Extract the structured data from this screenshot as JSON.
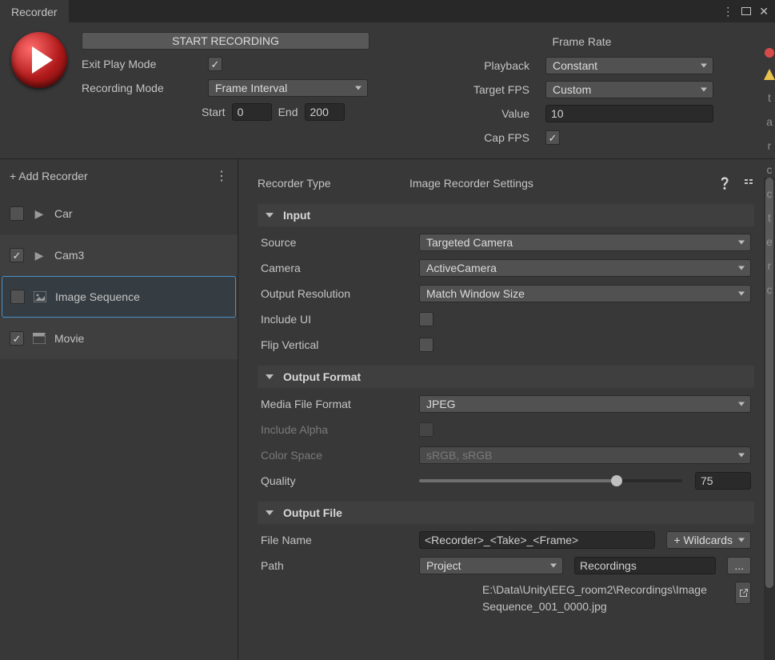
{
  "window": {
    "title": "Recorder"
  },
  "record": {
    "button": "START RECORDING",
    "exit_label": "Exit Play Mode",
    "exit_checked": true,
    "mode_label": "Recording Mode",
    "mode_value": "Frame Interval",
    "start_label": "Start",
    "start_value": "0",
    "end_label": "End",
    "end_value": "200"
  },
  "framerate": {
    "heading": "Frame Rate",
    "playback_label": "Playback",
    "playback_value": "Constant",
    "targetfps_label": "Target FPS",
    "targetfps_value": "Custom",
    "value_label": "Value",
    "value_value": "10",
    "capfps_label": "Cap FPS",
    "capfps_checked": true
  },
  "sidebar": {
    "add": "+ Add Recorder",
    "items": [
      {
        "label": "Car",
        "checked": false,
        "icon": "play"
      },
      {
        "label": "Cam3",
        "checked": true,
        "icon": "play"
      },
      {
        "label": "Image Sequence",
        "checked": false,
        "icon": "image",
        "selected": true
      },
      {
        "label": "Movie",
        "checked": true,
        "icon": "clapper"
      }
    ]
  },
  "inspector": {
    "type_label": "Recorder Type",
    "type_value": "Image Recorder Settings",
    "input": {
      "heading": "Input",
      "source_label": "Source",
      "source_value": "Targeted Camera",
      "camera_label": "Camera",
      "camera_value": "ActiveCamera",
      "outres_label": "Output Resolution",
      "outres_value": "Match Window Size",
      "includeui_label": "Include UI",
      "includeui_checked": false,
      "flip_label": "Flip Vertical",
      "flip_checked": false
    },
    "outputformat": {
      "heading": "Output Format",
      "mediaformat_label": "Media File Format",
      "mediaformat_value": "JPEG",
      "includealpha_label": "Include Alpha",
      "includealpha_checked": false,
      "colorspace_label": "Color Space",
      "colorspace_value": "sRGB, sRGB",
      "quality_label": "Quality",
      "quality_value": "75"
    },
    "outputfile": {
      "heading": "Output File",
      "filename_label": "File Name",
      "filename_value": "<Recorder>_<Take>_<Frame>",
      "wildcards_btn": "+ Wildcards",
      "path_label": "Path",
      "path_type": "Project",
      "path_rel": "Recordings",
      "browse_btn": "...",
      "path_full": "E:\\Data\\Unity\\EEG_room2\\Recordings\\Image Sequence_001_0000.jpg"
    }
  }
}
